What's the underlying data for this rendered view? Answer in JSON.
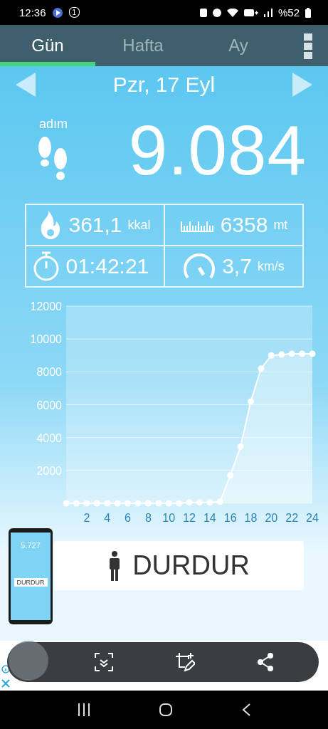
{
  "status_bar": {
    "time": "12:36",
    "notification_badge": "1",
    "battery": "%52"
  },
  "tabs": [
    {
      "label": "Gün",
      "selected": true
    },
    {
      "label": "Hafta",
      "selected": false
    },
    {
      "label": "Ay",
      "selected": false
    }
  ],
  "date": "Pzr, 17 Eyl",
  "steps": {
    "label": "adım",
    "value": "9.084"
  },
  "stats": [
    {
      "kind": "calories",
      "value": "361,1",
      "unit": "kkal"
    },
    {
      "kind": "distance",
      "value": "6358",
      "unit": "mt"
    },
    {
      "kind": "time",
      "value": "01:42:21"
    },
    {
      "kind": "speed",
      "value": "3,7",
      "unit": "km/s"
    }
  ],
  "chart_data": {
    "type": "area",
    "x": [
      0,
      1,
      2,
      3,
      4,
      5,
      6,
      7,
      8,
      9,
      10,
      11,
      12,
      13,
      14,
      15,
      16,
      17,
      18,
      19,
      20,
      21,
      22,
      23,
      24
    ],
    "series": [
      {
        "color": "#ffffff",
        "values": [
          0,
          0,
          0,
          0,
          0,
          0,
          0,
          0,
          0,
          0,
          0,
          0,
          50,
          50,
          50,
          100,
          1700,
          3450,
          6200,
          8200,
          9000,
          9050,
          9100,
          9100,
          9100
        ]
      }
    ],
    "grid": true,
    "xlim": [
      0,
      24
    ],
    "ylim": [
      0,
      12000
    ],
    "xticks": [
      2,
      4,
      6,
      8,
      10,
      12,
      14,
      16,
      18,
      20,
      22,
      24
    ],
    "yticks": [
      2000,
      4000,
      6000,
      8000,
      10000,
      12000
    ]
  },
  "stop_button": "DURDUR",
  "thumbnail": {
    "steps": "5.727",
    "button": "DURDUR"
  }
}
